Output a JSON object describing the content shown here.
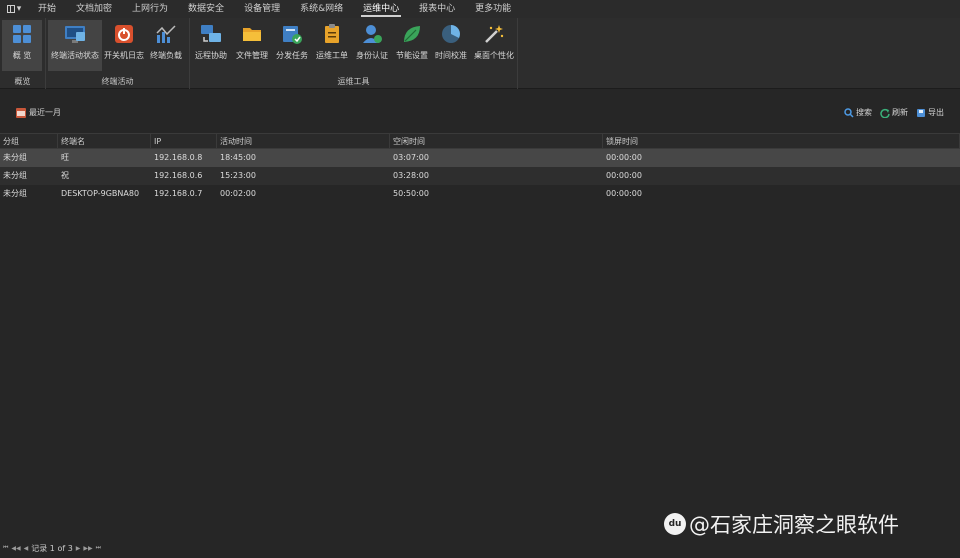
{
  "menu": {
    "app_menu_icon": "app-menu-icon",
    "items": [
      "开始",
      "文档加密",
      "上网行为",
      "数据安全",
      "设备管理",
      "系统&网络",
      "运维中心",
      "报表中心",
      "更多功能"
    ],
    "active_index": 6
  },
  "ribbon": {
    "groups": [
      {
        "label": "概览",
        "buttons": [
          {
            "label": "概 览",
            "icon": "overview-grid-icon"
          }
        ]
      },
      {
        "label": "终端活动",
        "buttons": [
          {
            "label": "终端活动状态",
            "icon": "terminal-activity-icon"
          },
          {
            "label": "开关机日志",
            "icon": "power-log-icon"
          },
          {
            "label": "终端负载",
            "icon": "terminal-load-icon"
          }
        ]
      },
      {
        "label": "运维工具",
        "buttons": [
          {
            "label": "远程协助",
            "icon": "remote-assist-icon"
          },
          {
            "label": "文件管理",
            "icon": "folder-icon"
          },
          {
            "label": "分发任务",
            "icon": "distribute-task-icon"
          },
          {
            "label": "运维工单",
            "icon": "clipboard-icon"
          },
          {
            "label": "身份认证",
            "icon": "identity-icon"
          },
          {
            "label": "节能设置",
            "icon": "leaf-icon"
          },
          {
            "label": "时间校准",
            "icon": "clock-icon"
          },
          {
            "label": "桌面个性化",
            "icon": "magic-wand-icon"
          }
        ]
      }
    ]
  },
  "toolbar": {
    "range_label": "最近一月",
    "search_label": "搜索",
    "refresh_label": "刷新",
    "export_label": "导出"
  },
  "table": {
    "columns": [
      "分组",
      "终端名",
      "IP",
      "活动时间",
      "空闲时间",
      "锁屏时间"
    ],
    "rows": [
      [
        "未分组",
        "旺",
        "192.168.0.8",
        "18:45:00",
        "03:07:00",
        "00:00:00"
      ],
      [
        "未分组",
        "祝",
        "192.168.0.6",
        "15:23:00",
        "03:28:00",
        "00:00:00"
      ],
      [
        "未分组",
        "DESKTOP-9GBNA80",
        "192.168.0.7",
        "00:02:00",
        "50:50:00",
        "00:00:00"
      ]
    ],
    "selected_row": 0
  },
  "pager": {
    "first": "⏮",
    "prev_page": "◀◀",
    "prev": "◀",
    "record_text": "记录 1 of 3",
    "next": "▶",
    "next_page": "▶▶",
    "last": "⏭"
  },
  "watermark": {
    "logo_text": "du",
    "text": "@石家庄洞察之眼软件"
  }
}
